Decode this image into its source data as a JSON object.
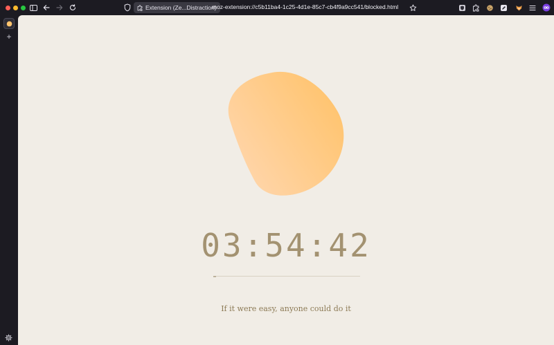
{
  "browser": {
    "extension_chip_label": "Extension (Ze...Distraction)",
    "url": "moz-extension://c5b11ba4-1c25-4d1e-85c7-cb4f9a9cc541/blocked.html",
    "icons": {
      "sidebar_toggle": "sidebar-icon",
      "back": "arrow-left-icon",
      "forward": "arrow-right-icon",
      "reload": "reload-icon",
      "shield": "shield-icon",
      "bookmark": "star-icon",
      "extensions": [
        "shield-extension-icon",
        "puzzle-icon",
        "cookie-icon",
        "pen-icon",
        "fox-icon",
        "menu-icon",
        "profile-icon"
      ]
    }
  },
  "sidebar": {
    "add_label": "+",
    "icons": {
      "active_tab": "tab-favicon-icon",
      "settings": "gear-icon"
    }
  },
  "page": {
    "timer": "03:54:42",
    "progress": 0.02,
    "quote": "If it were easy, anyone could do it",
    "colors": {
      "background": "#f1ede6",
      "timer": "#a39271",
      "quote": "#8c7a55",
      "blob_start": "#ffc980",
      "blob_end": "#ffd6b0"
    }
  }
}
